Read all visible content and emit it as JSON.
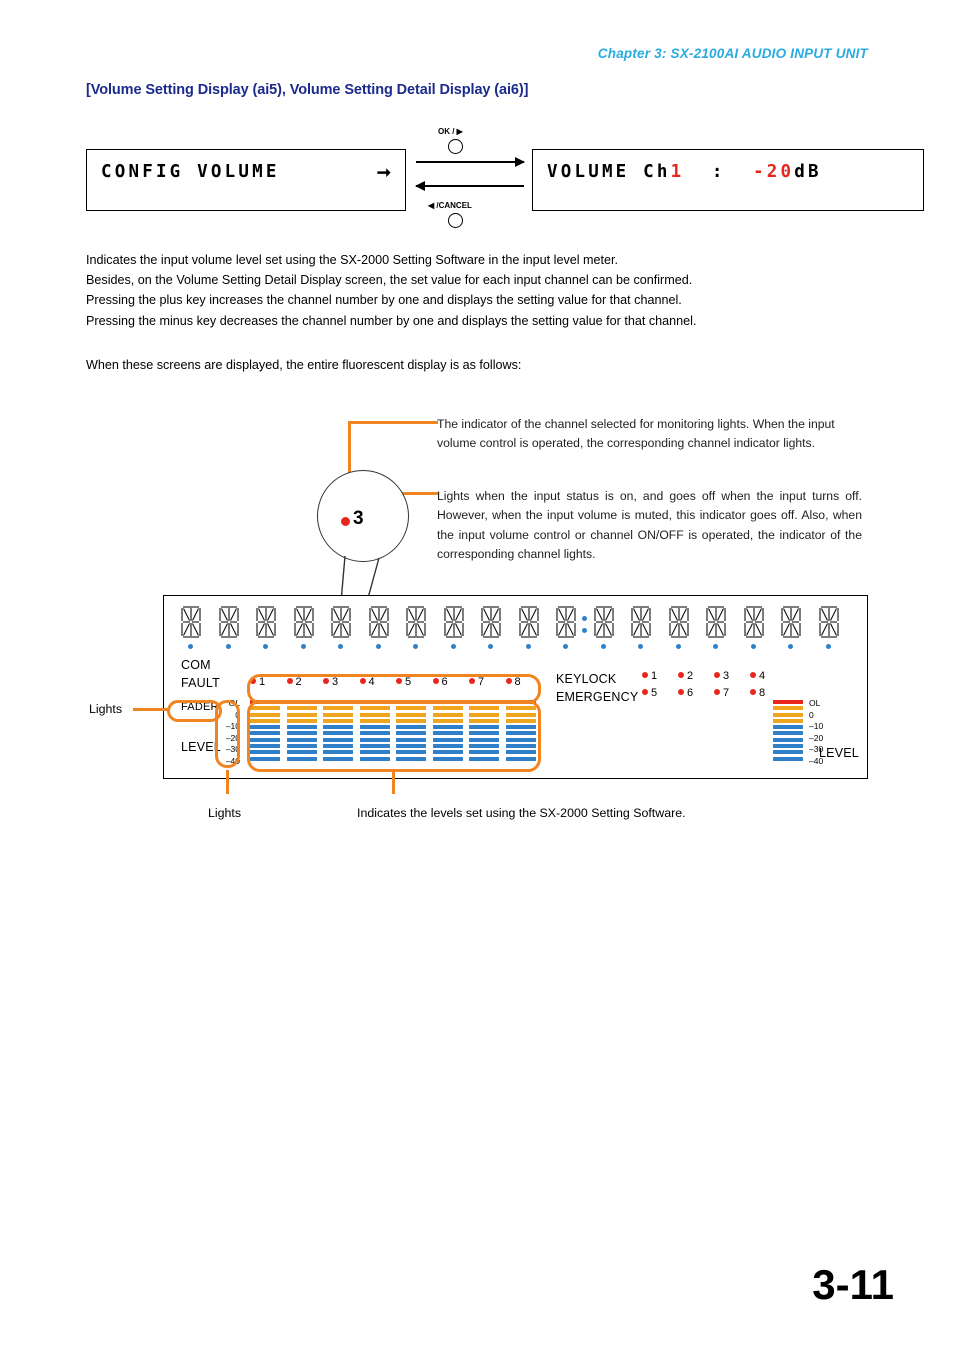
{
  "header": {
    "chapter": "Chapter 3:  SX-2100AI AUDIO INPUT UNIT"
  },
  "section": {
    "title": "[Volume Setting Display (ai5), Volume Setting Detail Display (ai6)]"
  },
  "lcd": {
    "left": {
      "text": "CONFIG VOLUME",
      "cursor_icon": "right-arrow-cursor-icon"
    },
    "right": {
      "prefix": "VOLUME Ch",
      "channel": "1",
      "separator": "  :  ",
      "value": "-20",
      "unit": "dB"
    }
  },
  "transition": {
    "ok_label": "OK / ▶",
    "cancel_label": "◀ /CANCEL",
    "forward_arrow_icon": "arrow-right-icon",
    "back_arrow_icon": "arrow-left-icon",
    "ok_button_icon": "round-button-icon",
    "cancel_button_icon": "round-button-icon"
  },
  "body": {
    "lines": [
      "Indicates the input volume level set using the SX-2000 Setting Software in the input level meter.",
      "Besides, on the Volume Setting Detail Display screen, the set value for each input channel can be confirmed.",
      "Pressing the plus key increases the channel number by one and displays the setting value for that channel.",
      "Pressing the minus key decreases the channel number by one and displays the setting value for that channel."
    ],
    "closing": "When these screens are displayed, the entire fluorescent display is as follows:"
  },
  "callouts": [
    {
      "id": "callout-monitor-indicator",
      "text": "The indicator of the channel selected for monitoring lights. When the input volume control is operated, the corresponding channel indicator lights."
    },
    {
      "id": "callout-input-status",
      "text": "Lights when the input status is on, and goes off when the input turns off. However, when the input volume is muted, this indicator goes off. Also, when the input volume control or channel ON/OFF is operated, the indicator of the corresponding channel lights."
    }
  ],
  "magnifier": {
    "number": "3",
    "dot_color": "#E8261B"
  },
  "panel": {
    "segment_character_count": 18,
    "colon_after_index": 11,
    "labels": {
      "com": "COM",
      "fault": "FAULT",
      "fader": "FADER",
      "level": "LEVEL",
      "keylock": "KEYLOCK",
      "emergency": "EMERGENCY",
      "level_right": "LEVEL"
    },
    "channel_indicators": [
      "1",
      "2",
      "3",
      "4",
      "5",
      "6",
      "7",
      "8"
    ],
    "keylock_indicators": [
      [
        "1",
        "2",
        "3",
        "4"
      ],
      [
        "5",
        "6",
        "7",
        "8"
      ]
    ],
    "scale_labels": [
      "OL",
      "0",
      "–10",
      "–20",
      "–30",
      "–40"
    ],
    "meter_channels": 8,
    "meter_segments": {
      "red": 1,
      "orange": 3,
      "blue": 6
    },
    "colors": {
      "red": "#E8261B",
      "orange": "#F0A51E",
      "blue": "#2F80C8",
      "highlight": "#F08421"
    }
  },
  "captions": {
    "lights_left": "Lights",
    "lights_bottom": "Lights",
    "levels_bottom": "Indicates the levels set using the SX-2000 Setting Software."
  },
  "footer": {
    "page": "3-11"
  }
}
